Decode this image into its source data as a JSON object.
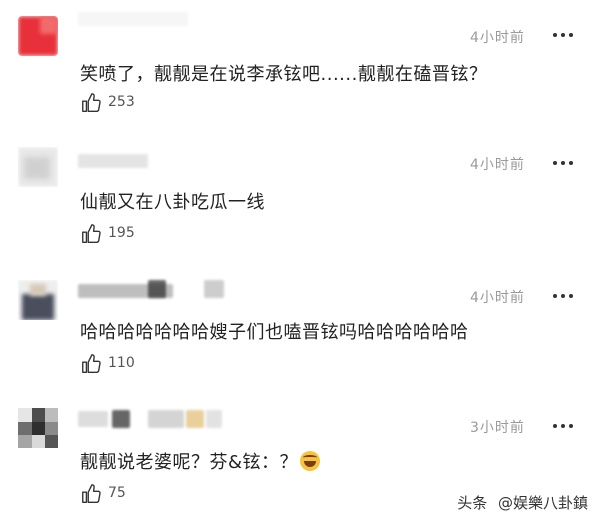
{
  "comments": [
    {
      "time": "4小时前",
      "text": "笑喷了，靓靓是在说李承铉吧......靓靓在磕晋铉？",
      "likes": "253",
      "username_visible": ""
    },
    {
      "time": "4小时前",
      "text": "仙靓又在八卦吃瓜一线",
      "likes": "195",
      "username_visible": ""
    },
    {
      "time": "4小时前",
      "text": "哈哈哈哈哈哈哈嫂子们也嗑晋铉吗哈哈哈哈哈哈",
      "likes": "110",
      "username_visible": ""
    },
    {
      "time": "3小时前",
      "text_before_emoji": "靓靓说老婆呢？芬&铉：？",
      "emoji": "rolling-on-floor-laughing-emoji",
      "likes": "75",
      "username_visible": ""
    }
  ],
  "watermark": {
    "platform": "头条",
    "account": "@娱樂八卦鎮"
  },
  "colors": {
    "time": "#9a9a9a",
    "text": "#222222",
    "like_count": "#555555",
    "avatar_red": "#e8303a"
  }
}
